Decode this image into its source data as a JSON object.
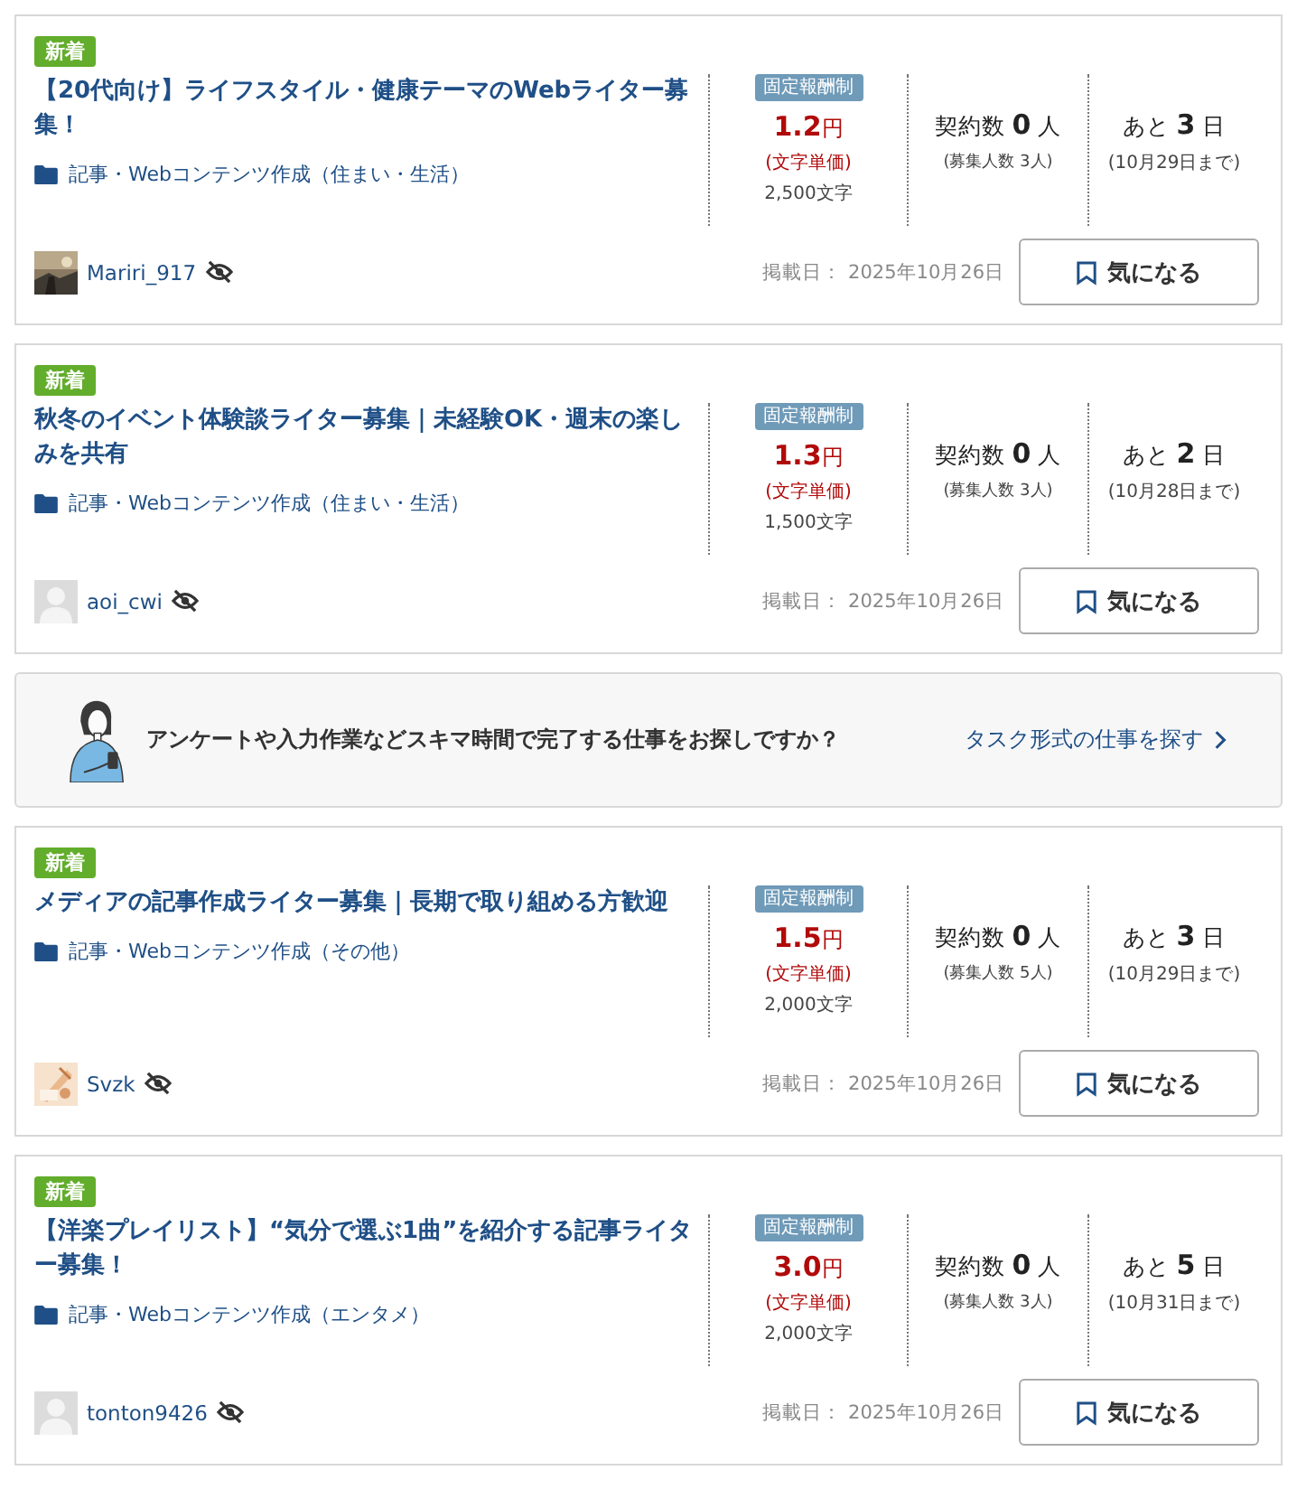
{
  "items": [
    {
      "kind": "job",
      "badge": "新着",
      "title": "【20代向け】ライフスタイル・健康テーマのWebライター募集！",
      "category": "記事・Webコンテンツ作成（住まい・生活）",
      "pay_type": "固定報酬制",
      "price": "1.2",
      "price_unit": "円",
      "price_note": "(文字単価)",
      "chars": "2,500文字",
      "contracts_label": "契約数",
      "contracts": "0",
      "contracts_unit": "人",
      "recruit": "(募集人数 3人)",
      "remain_label": "あと",
      "remain": "3",
      "remain_unit": "日",
      "deadline": "(10月29日まで)",
      "user": "Mariri_917",
      "posted": "掲載日： 2025年10月26日",
      "button": "気になる"
    },
    {
      "kind": "job",
      "badge": "新着",
      "title": "秋冬のイベント体験談ライター募集｜未経験OK・週末の楽しみを共有",
      "category": "記事・Webコンテンツ作成（住まい・生活）",
      "pay_type": "固定報酬制",
      "price": "1.3",
      "price_unit": "円",
      "price_note": "(文字単価)",
      "chars": "1,500文字",
      "contracts_label": "契約数",
      "contracts": "0",
      "contracts_unit": "人",
      "recruit": "(募集人数 3人)",
      "remain_label": "あと",
      "remain": "2",
      "remain_unit": "日",
      "deadline": "(10月28日まで)",
      "user": "aoi_cwi",
      "avatar": {
        "kind": "default"
      },
      "posted": "掲載日： 2025年10月26日",
      "button": "気になる"
    },
    {
      "kind": "banner",
      "text": "アンケートや入力作業などスキマ時間で完了する仕事をお探しですか？",
      "link": "タスク形式の仕事を探す"
    },
    {
      "kind": "job",
      "badge": "新着",
      "title": "メディアの記事作成ライター募集｜長期で取り組める方歓迎",
      "category": "記事・Webコンテンツ作成（その他）",
      "pay_type": "固定報酬制",
      "price": "1.5",
      "price_unit": "円",
      "price_note": "(文字単価)",
      "chars": "2,000文字",
      "contracts_label": "契約数",
      "contracts": "0",
      "contracts_unit": "人",
      "recruit": "(募集人数 5人)",
      "remain_label": "あと",
      "remain": "3",
      "remain_unit": "日",
      "deadline": "(10月29日まで)",
      "user": "Svzk",
      "posted": "掲載日： 2025年10月26日",
      "button": "気になる"
    },
    {
      "kind": "job",
      "badge": "新着",
      "title": "【洋楽プレイリスト】“気分で選ぶ1曲”を紹介する記事ライター募集！",
      "category": "記事・Webコンテンツ作成（エンタメ）",
      "pay_type": "固定報酬制",
      "price": "3.0",
      "price_unit": "円",
      "price_note": "(文字単価)",
      "chars": "2,000文字",
      "contracts_label": "契約数",
      "contracts": "0",
      "contracts_unit": "人",
      "recruit": "(募集人数 3人)",
      "remain_label": "あと",
      "remain": "5",
      "remain_unit": "日",
      "deadline": "(10月31日まで)",
      "user": "tonton9426",
      "avatar": {
        "kind": "default"
      },
      "posted": "掲載日： 2025年10月26日",
      "button": "気になる"
    }
  ]
}
